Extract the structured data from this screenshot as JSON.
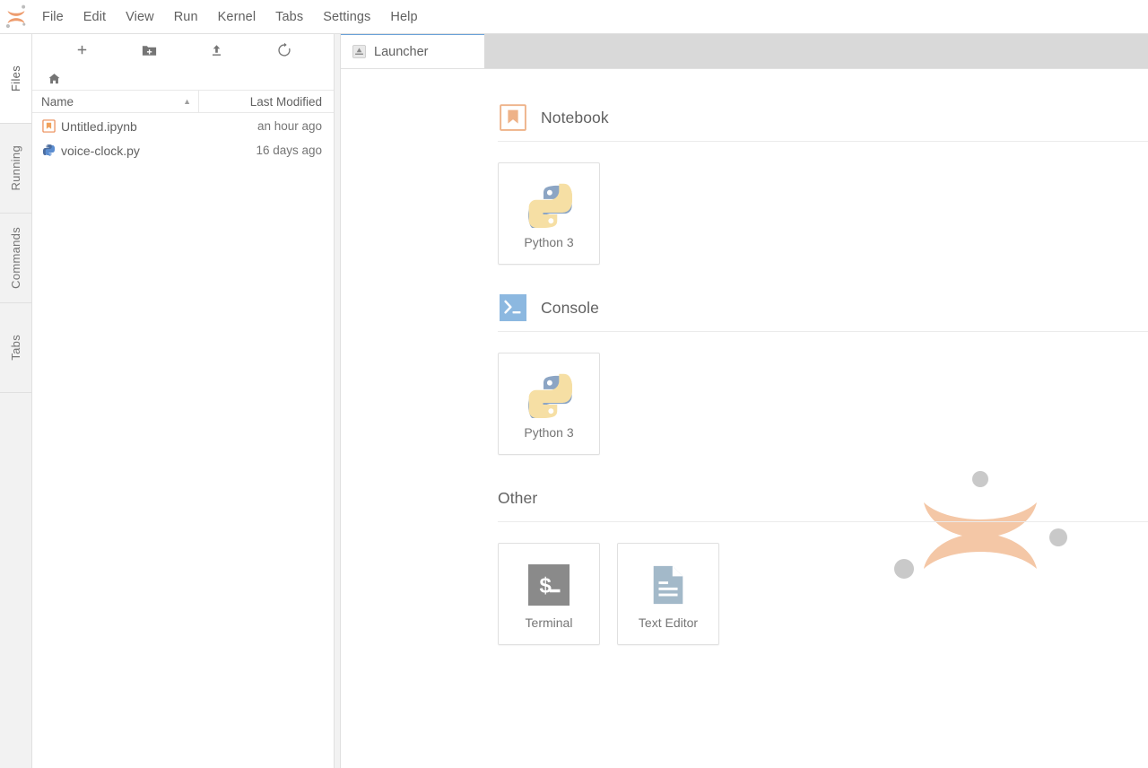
{
  "app": {
    "logo_name": "jupyter-logo",
    "accent_blue": "#6aa1d8",
    "accent_orange": "#f0a05a",
    "watermark_orange": "#f3c3a0",
    "watermark_gray": "#c8c8c8"
  },
  "menubar": {
    "items": [
      {
        "label": "File"
      },
      {
        "label": "Edit"
      },
      {
        "label": "View"
      },
      {
        "label": "Run"
      },
      {
        "label": "Kernel"
      },
      {
        "label": "Tabs"
      },
      {
        "label": "Settings"
      },
      {
        "label": "Help"
      }
    ]
  },
  "sidebar": {
    "tabs": [
      {
        "label": "Files",
        "active": true
      },
      {
        "label": "Running",
        "active": false
      },
      {
        "label": "Commands",
        "active": false
      },
      {
        "label": "Tabs",
        "active": false
      }
    ]
  },
  "filebrowser": {
    "toolbar": [
      {
        "name": "new-launcher-button",
        "icon": "plus-icon",
        "title": "New Launcher"
      },
      {
        "name": "new-folder-button",
        "icon": "new-folder-icon",
        "title": "New Folder"
      },
      {
        "name": "upload-button",
        "icon": "upload-icon",
        "title": "Upload Files"
      },
      {
        "name": "refresh-button",
        "icon": "refresh-icon",
        "title": "Refresh File List"
      }
    ],
    "breadcrumb": {
      "icon": "home-icon",
      "label": ""
    },
    "columns": {
      "name": "Name",
      "last_modified": "Last Modified",
      "sort_indicator": "▲"
    },
    "files": [
      {
        "name": "Untitled.ipynb",
        "modified": "an hour ago",
        "icon": "notebook-icon"
      },
      {
        "name": "voice-clock.py",
        "modified": "16 days ago",
        "icon": "python-file-icon"
      }
    ]
  },
  "dock": {
    "tabs": [
      {
        "label": "Launcher",
        "icon": "launcher-icon",
        "active": true
      }
    ]
  },
  "launcher": {
    "sections": [
      {
        "title": "Notebook",
        "icon": "notebook-icon",
        "cards": [
          {
            "label": "Python 3",
            "icon": "python-icon"
          }
        ]
      },
      {
        "title": "Console",
        "icon": "console-icon",
        "cards": [
          {
            "label": "Python 3",
            "icon": "python-icon"
          }
        ]
      },
      {
        "title": "Other",
        "icon": "",
        "cards": [
          {
            "label": "Terminal",
            "icon": "terminal-icon"
          },
          {
            "label": "Text Editor",
            "icon": "text-editor-icon"
          }
        ]
      }
    ]
  }
}
